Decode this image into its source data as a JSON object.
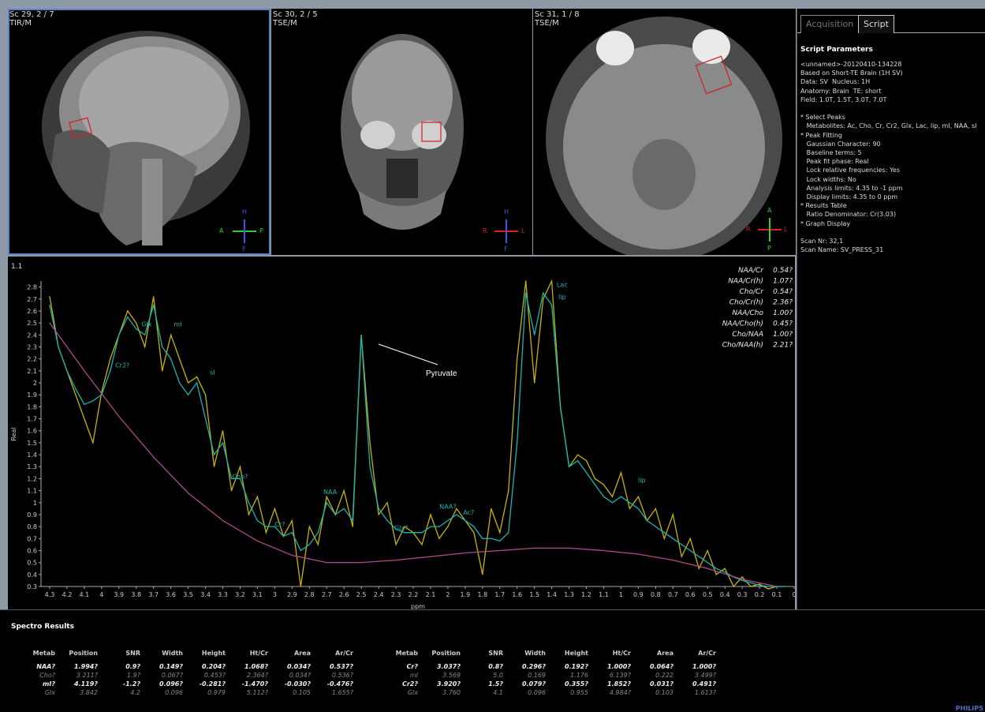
{
  "viewports": [
    {
      "series": "Sc 29, 2 / 7",
      "sequence": "TIR/M",
      "orient": {
        "left": "A",
        "right": "P",
        "top": "H",
        "bottom": "F"
      }
    },
    {
      "series": "Sc 30, 2 / 5",
      "sequence": "TSE/M",
      "orient": {
        "left": "R",
        "right": "L",
        "top": "H",
        "bottom": "F"
      }
    },
    {
      "series": "Sc 31, 1 / 8",
      "sequence": "TSE/M",
      "orient": {
        "left": "R",
        "right": "L",
        "top": "A",
        "bottom": "P"
      }
    }
  ],
  "side_panel": {
    "tabs": [
      "Acquisition",
      "Script"
    ],
    "active_tab": "Script",
    "title": "Script Parameters",
    "lines": [
      "<unnamed>-20120410-134228",
      "Based on Short-TE Brain (1H SV)",
      "Data: SV  Nucleus: 1H",
      "Anatomy: Brain  TE: short",
      "Field: 1.0T, 1.5T, 3.0T, 7.0T",
      "",
      "* Select Peaks",
      "   Metabolites: Ac, Cho, Cr, Cr2, Glx, Lac, lip, mI, NAA, sI",
      "* Peak Fitting",
      "   Gaussian Character: 90",
      "   Baseline terms: 5",
      "   Peak fit phase: Real",
      "   Lock relative frequencies: Yes",
      "   Lock widths: No",
      "   Analysis limits: 4.35 to -1 ppm",
      "   Display limits: 4.35 to 0 ppm",
      "* Results Table",
      "   Ratio Denominator: Cr(3.03)",
      "* Graph Display",
      "",
      "Scan Nr: 32,1",
      "Scan Name: SV_PRESS_31"
    ]
  },
  "spectrum": {
    "label": "1.1",
    "ylabel": "Real",
    "xlabel": "ppm",
    "annotation": "Pyruvate",
    "ratios": [
      [
        "NAA/Cr",
        "0.54?"
      ],
      [
        "NAA/Cr(h)",
        "1.07?"
      ],
      [
        "Cho/Cr",
        "0.54?"
      ],
      [
        "Cho/Cr(h)",
        "2.36?"
      ],
      [
        "NAA/Cho",
        "1.00?"
      ],
      [
        "NAA/Cho(h)",
        "0.45?"
      ],
      [
        "Cho/NAA",
        "1.00?"
      ],
      [
        "Cho/NAA(h)",
        "2.21?"
      ]
    ]
  },
  "chart_data": {
    "type": "line",
    "xlabel": "ppm",
    "ylabel": "Real",
    "xlim": [
      4.35,
      0
    ],
    "ylim": [
      0.3,
      2.85
    ],
    "xticks": [
      "4.3",
      "4.2",
      "4.1",
      "4",
      "3.9",
      "3.8",
      "3.7",
      "3.6",
      "3.5",
      "3.4",
      "3.3",
      "3.2",
      "3.1",
      "3",
      "2.9",
      "2.8",
      "2.7",
      "2.6",
      "2.5",
      "2.4",
      "2.3",
      "2.2",
      "2.1",
      "2",
      "1.9",
      "1.8",
      "1.7",
      "1.6",
      "1.5",
      "1.4",
      "1.3",
      "1.2",
      "1.1",
      "1",
      "0.9",
      "0.8",
      "0.7",
      "0.6",
      "0.5",
      "0.4",
      "0.3",
      "0.2",
      "0.1",
      "0"
    ],
    "yticks": [
      "2.8",
      "2.7",
      "2.6",
      "2.5",
      "2.4",
      "2.3",
      "2.2",
      "2.1",
      "2",
      "1.9",
      "1.8",
      "1.7",
      "1.6",
      "1.5",
      "1.4",
      "1.3",
      "1.2",
      "1.1",
      "1",
      "0.9",
      "0.8",
      "0.7",
      "0.6",
      "0.5",
      "0.4",
      "0.3"
    ],
    "series": [
      {
        "color": "#c8b400",
        "x": [
          4.3,
          4.25,
          4.2,
          4.15,
          4.1,
          4.05,
          4.0,
          3.95,
          3.9,
          3.85,
          3.8,
          3.75,
          3.7,
          3.65,
          3.6,
          3.55,
          3.5,
          3.45,
          3.4,
          3.35,
          3.3,
          3.25,
          3.2,
          3.15,
          3.1,
          3.05,
          3.0,
          2.95,
          2.9,
          2.85,
          2.8,
          2.75,
          2.7,
          2.65,
          2.6,
          2.55,
          2.5,
          2.45,
          2.4,
          2.35,
          2.3,
          2.25,
          2.2,
          2.15,
          2.1,
          2.05,
          2.0,
          1.95,
          1.9,
          1.85,
          1.8,
          1.75,
          1.7,
          1.65,
          1.6,
          1.55,
          1.5,
          1.45,
          1.4,
          1.35,
          1.3,
          1.25,
          1.2,
          1.15,
          1.1,
          1.05,
          1.0,
          0.95,
          0.9,
          0.85,
          0.8,
          0.75,
          0.7,
          0.65,
          0.6,
          0.55,
          0.5,
          0.45,
          0.4,
          0.35,
          0.3,
          0.25,
          0.2,
          0.15,
          0.1,
          0.05
        ],
        "y": [
          2.72,
          2.3,
          2.1,
          1.9,
          1.7,
          1.5,
          1.92,
          2.2,
          2.4,
          2.6,
          2.5,
          2.3,
          2.72,
          2.1,
          2.4,
          2.2,
          2.0,
          2.05,
          1.9,
          1.3,
          1.6,
          1.1,
          1.3,
          0.9,
          1.05,
          0.75,
          0.95,
          0.72,
          0.85,
          0.3,
          0.8,
          0.65,
          1.05,
          0.9,
          1.1,
          0.8,
          2.4,
          1.5,
          0.9,
          1.0,
          0.65,
          0.8,
          0.75,
          0.65,
          0.9,
          0.7,
          0.8,
          0.95,
          0.85,
          0.75,
          0.4,
          0.95,
          0.75,
          1.1,
          2.2,
          2.85,
          2.0,
          2.7,
          2.85,
          1.8,
          1.3,
          1.4,
          1.35,
          1.2,
          1.15,
          1.05,
          1.25,
          0.95,
          1.05,
          0.85,
          0.95,
          0.7,
          0.9,
          0.55,
          0.7,
          0.45,
          0.6,
          0.4,
          0.45,
          0.3,
          0.38,
          0.3,
          0.32,
          0.28,
          0.3,
          0.3
        ]
      },
      {
        "color": "#17b5b5",
        "x": [
          4.3,
          4.25,
          4.2,
          4.15,
          4.1,
          4.05,
          4.0,
          3.95,
          3.9,
          3.85,
          3.8,
          3.75,
          3.7,
          3.65,
          3.6,
          3.55,
          3.5,
          3.45,
          3.4,
          3.35,
          3.3,
          3.25,
          3.2,
          3.15,
          3.1,
          3.05,
          3.0,
          2.95,
          2.9,
          2.85,
          2.8,
          2.75,
          2.7,
          2.65,
          2.6,
          2.55,
          2.5,
          2.45,
          2.4,
          2.35,
          2.3,
          2.25,
          2.2,
          2.15,
          2.1,
          2.05,
          2.0,
          1.95,
          1.9,
          1.85,
          1.8,
          1.75,
          1.7,
          1.65,
          1.6,
          1.55,
          1.5,
          1.45,
          1.4,
          1.35,
          1.3,
          1.25,
          1.2,
          1.15,
          1.1,
          1.05,
          1.0,
          0.95,
          0.9,
          0.85,
          0.8,
          0.75,
          0.7,
          0.65,
          0.6,
          0.55,
          0.5,
          0.45,
          0.4,
          0.35,
          0.3,
          0.25,
          0.2,
          0.15,
          0.1,
          0.05
        ],
        "y": [
          2.65,
          2.3,
          2.1,
          1.95,
          1.82,
          1.85,
          1.9,
          2.1,
          2.4,
          2.55,
          2.45,
          2.4,
          2.65,
          2.3,
          2.2,
          2.0,
          1.9,
          2.0,
          1.7,
          1.4,
          1.5,
          1.2,
          1.2,
          1.0,
          0.85,
          0.8,
          0.8,
          0.72,
          0.75,
          0.6,
          0.65,
          0.75,
          1.0,
          0.9,
          0.95,
          0.85,
          2.4,
          1.3,
          0.95,
          0.85,
          0.78,
          0.75,
          0.75,
          0.75,
          0.8,
          0.8,
          0.85,
          0.9,
          0.85,
          0.8,
          0.7,
          0.7,
          0.68,
          0.75,
          1.5,
          2.75,
          2.4,
          2.75,
          2.65,
          1.8,
          1.3,
          1.35,
          1.25,
          1.15,
          1.05,
          1.0,
          1.05,
          1.0,
          0.95,
          0.85,
          0.8,
          0.75,
          0.7,
          0.65,
          0.6,
          0.55,
          0.5,
          0.45,
          0.42,
          0.38,
          0.35,
          0.33,
          0.31,
          0.3,
          0.3,
          0.3
        ]
      },
      {
        "color": "#b04a8c",
        "x": [
          4.3,
          4.1,
          3.9,
          3.7,
          3.5,
          3.3,
          3.1,
          2.9,
          2.7,
          2.5,
          2.3,
          2.1,
          1.9,
          1.7,
          1.5,
          1.3,
          1.1,
          0.9,
          0.7,
          0.5,
          0.3,
          0.1
        ],
        "y": [
          2.5,
          2.1,
          1.72,
          1.38,
          1.08,
          0.85,
          0.68,
          0.56,
          0.5,
          0.5,
          0.52,
          0.55,
          0.58,
          0.6,
          0.62,
          0.62,
          0.6,
          0.57,
          0.52,
          0.45,
          0.36,
          0.3
        ]
      }
    ],
    "peak_labels": [
      {
        "text": "Cr2?",
        "x": 3.88,
        "y": 2.13
      },
      {
        "text": "Glx",
        "x": 3.74,
        "y": 2.47
      },
      {
        "text": "mI",
        "x": 3.56,
        "y": 2.47
      },
      {
        "text": "sI",
        "x": 3.36,
        "y": 2.07
      },
      {
        "text": "Cho?",
        "x": 3.2,
        "y": 1.2
      },
      {
        "text": "Cr?",
        "x": 2.97,
        "y": 0.8
      },
      {
        "text": "NAA",
        "x": 2.68,
        "y": 1.07
      },
      {
        "text": "Glx?",
        "x": 2.27,
        "y": 0.77
      },
      {
        "text": "NAA?",
        "x": 2.0,
        "y": 0.95
      },
      {
        "text": "Ac?",
        "x": 1.88,
        "y": 0.9
      },
      {
        "text": "Lac",
        "x": 1.34,
        "y": 2.8
      },
      {
        "text": "lip",
        "x": 1.34,
        "y": 2.7
      },
      {
        "text": "lip",
        "x": 0.88,
        "y": 1.17
      }
    ]
  },
  "results": {
    "title": "Spectro Results",
    "headers": [
      "Metab",
      "Position",
      "SNR",
      "Width",
      "Height",
      "Ht/Cr",
      "Area",
      "Ar/Cr"
    ],
    "left": [
      [
        "NAA?",
        "1.994?",
        "0.9?",
        "0.149?",
        "0.204?",
        "1.068?",
        "0.034?",
        "0.537?"
      ],
      [
        "Cho?",
        "3.211?",
        "1.9?",
        "0.067?",
        "0.453?",
        "2.364?",
        "0.034?",
        "0.536?"
      ],
      [
        "mI?",
        "4.119?",
        "-1.2?",
        "0.096?",
        "-0.281?",
        "-1.470?",
        "-0.030?",
        "-0.476?"
      ],
      [
        "Glx",
        "3.842",
        "4.2",
        "0.096",
        "0.979",
        "5.112?",
        "0.105",
        "1.655?"
      ]
    ],
    "right": [
      [
        "Cr?",
        "3.037?",
        "0.8?",
        "0.296?",
        "0.192?",
        "1.000?",
        "0.064?",
        "1.000?"
      ],
      [
        "mI",
        "3.569",
        "5.0",
        "0.169",
        "1.176",
        "6.139?",
        "0.222",
        "3.499?"
      ],
      [
        "Cr2?",
        "3.920?",
        "1.5?",
        "0.079?",
        "0.355?",
        "1.852?",
        "0.031?",
        "0.491?"
      ],
      [
        "Glx",
        "3.760",
        "4.1",
        "0.096",
        "0.955",
        "4.984?",
        "0.103",
        "1.613?"
      ]
    ],
    "brand": "PHILIPS"
  }
}
